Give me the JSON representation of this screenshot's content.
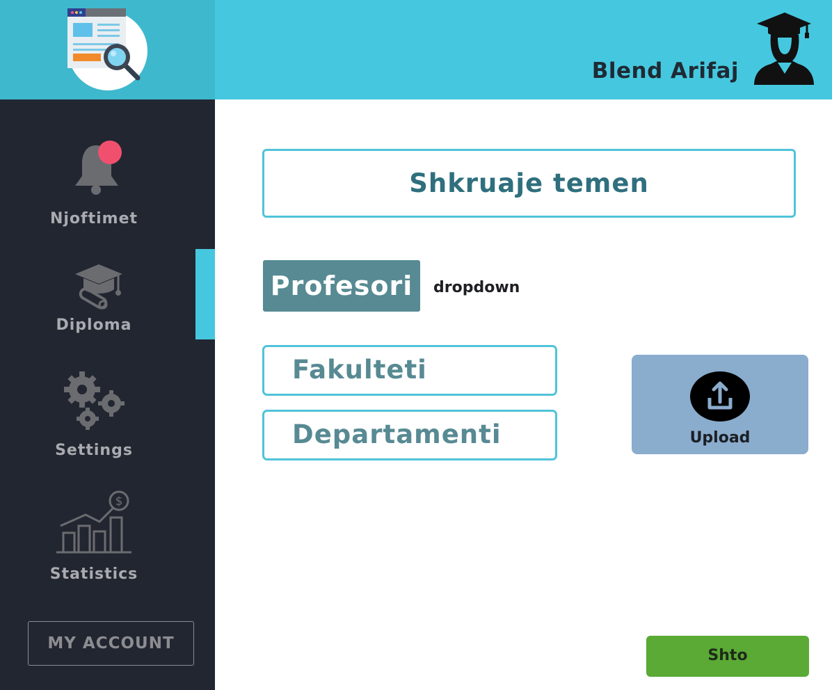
{
  "header": {
    "user_name": "Blend Arifaj"
  },
  "sidebar": {
    "items": [
      {
        "label": "Njoftimet"
      },
      {
        "label": "Diploma"
      },
      {
        "label": "Settings"
      },
      {
        "label": "Statistics"
      }
    ],
    "account_label": "MY ACCOUNT"
  },
  "form": {
    "topic_placeholder": "Shkruaje temen",
    "professor_label": "Profesori",
    "professor_dropdown": "dropdown",
    "faculty_label": "Fakulteti",
    "department_label": "Departamenti",
    "upload_label": "Upload",
    "submit_label": "Shto"
  },
  "colors": {
    "accent": "#45c8df",
    "sidebar_bg": "#222631",
    "notification_dot": "#f0506e",
    "submit_green": "#5aaa35"
  },
  "icons": [
    "document-search-logo-icon",
    "graduate-avatar-icon",
    "bell-icon",
    "graduation-cap-icon",
    "gears-icon",
    "statistics-chart-icon",
    "upload-icon"
  ]
}
